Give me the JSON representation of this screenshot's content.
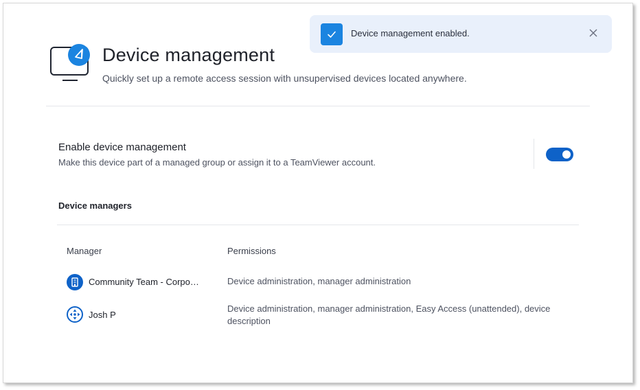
{
  "header": {
    "title": "Device management",
    "subtitle": "Quickly set up a remote access session with unsupervised devices located anywhere.",
    "icon": "monitor-with-paper-plane-icon"
  },
  "enable_section": {
    "title": "Enable device management",
    "description": "Make this device part of a managed group or assign it to a TeamViewer account.",
    "toggle_on": true
  },
  "managers": {
    "title": "Device managers",
    "columns": {
      "manager": "Manager",
      "permissions": "Permissions"
    },
    "rows": [
      {
        "name": "Community Team - Corpo…",
        "icon": "company-building-icon",
        "permissions": "Device administration, manager administration"
      },
      {
        "name": "Josh P",
        "icon": "teamviewer-logo-icon",
        "permissions": "Device administration, manager administration, Easy Access (unattended), device description"
      }
    ]
  },
  "toast": {
    "message": "Device management enabled."
  },
  "colors": {
    "accent": "#0e62c8",
    "toast_bg": "#e9f0fb",
    "check_bg": "#1b84e0"
  }
}
